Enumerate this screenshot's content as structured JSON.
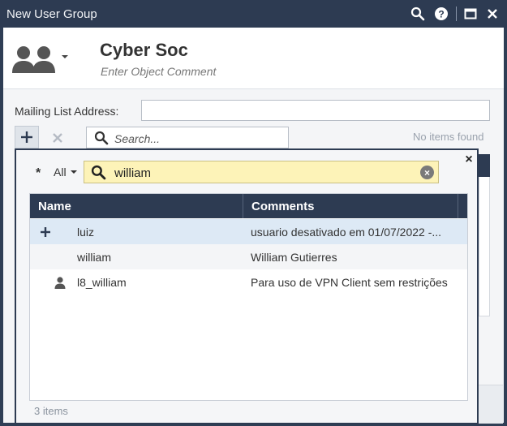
{
  "window": {
    "title": "New User Group"
  },
  "header": {
    "object_name": "Cyber Soc",
    "comment_placeholder": "Enter Object Comment"
  },
  "form": {
    "mailing_list_label": "Mailing List Address:",
    "mailing_list_value": "",
    "search_placeholder": "Search...",
    "no_items_text": "No items found"
  },
  "popup": {
    "filter_label": "All",
    "search_value": "william",
    "columns": [
      "Name",
      "Comments"
    ],
    "rows": [
      {
        "icon": "add-icon",
        "name": "luiz",
        "comment": "usuario desativado em 01/07/2022 -..."
      },
      {
        "icon": "",
        "name": "william",
        "comment": "William Gutierres"
      },
      {
        "icon": "user-icon",
        "name": "l8_william",
        "comment": "Para uso de VPN Client sem restrições"
      }
    ],
    "footer": "3 items"
  },
  "colors": {
    "titlebar": "#2d3b52",
    "selected_row": "#dde9f5",
    "search_highlight": "#fdf3b8"
  }
}
